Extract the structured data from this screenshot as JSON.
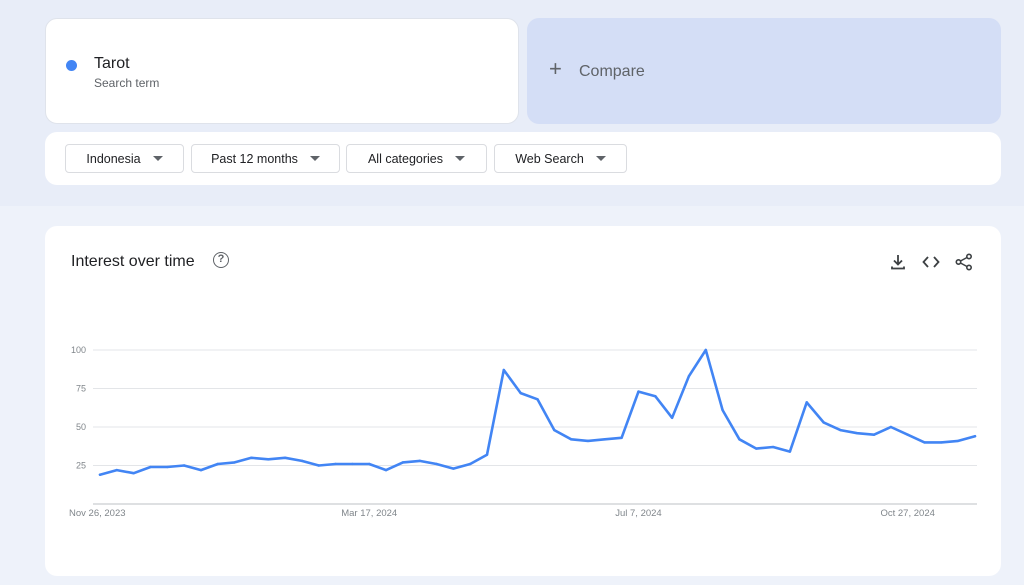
{
  "search_term": {
    "name": "Tarot",
    "subtitle": "Search term",
    "color": "#4285f4"
  },
  "compare": {
    "icon": "plus-icon",
    "label": "Compare"
  },
  "filters": [
    {
      "label": "Indonesia",
      "icon": "caret-down-icon"
    },
    {
      "label": "Past 12 months",
      "icon": "caret-down-icon"
    },
    {
      "label": "All categories",
      "icon": "caret-down-icon"
    },
    {
      "label": "Web Search",
      "icon": "caret-down-icon"
    }
  ],
  "chart_panel": {
    "title": "Interest over time",
    "help_icon": "help-circle-icon",
    "toolbar_icons": [
      "download-icon",
      "embed-code-icon",
      "share-icon"
    ]
  },
  "chart_data": {
    "type": "line",
    "title": "Interest over time",
    "xlabel": "",
    "ylabel": "",
    "ylim": [
      0,
      100
    ],
    "y_ticks": [
      25,
      50,
      75,
      100
    ],
    "x_ticks": [
      "Nov 26, 2023",
      "Mar 17, 2024",
      "Jul 7, 2024",
      "Oct 27, 2024"
    ],
    "x_tick_indices": [
      0,
      16,
      32,
      48
    ],
    "grid": true,
    "series": [
      {
        "name": "Tarot",
        "color": "#4285f4",
        "values": [
          19,
          22,
          20,
          24,
          24,
          25,
          22,
          26,
          27,
          30,
          29,
          30,
          28,
          25,
          26,
          26,
          26,
          22,
          27,
          28,
          26,
          23,
          26,
          32,
          87,
          72,
          68,
          48,
          42,
          41,
          42,
          43,
          73,
          70,
          56,
          83,
          100,
          61,
          42,
          36,
          37,
          34,
          66,
          53,
          48,
          46,
          45,
          50,
          45,
          40,
          40,
          41,
          44
        ]
      }
    ]
  }
}
